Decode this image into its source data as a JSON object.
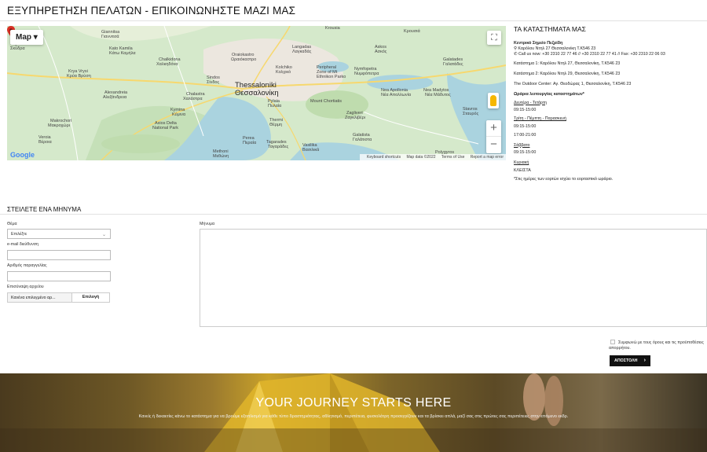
{
  "page_title": "ΕΞΥΠΗΡΕΤΗΣΗ ΠΕΛΑΤΩΝ - ΕΠΙΚΟΙΝΩΝΗΣΤΕ ΜΑΖΙ ΜΑΣ",
  "map": {
    "type_label": "Map",
    "fullscreen_icon": "fullscreen-icon",
    "zoom_in": "+",
    "zoom_out": "−",
    "google": "Google",
    "city_latin": "Thessaloniki",
    "city_greek": "Θεσσαλονίκη",
    "footer": [
      "Keyboard shortcuts",
      "Map data ©2022",
      "Terms of Use",
      "Report a map error"
    ],
    "labels": [
      "Giannitsa",
      "Γιαννιτσά",
      "Krya Vrysi",
      "Κρύα Βρύση",
      "Alexandreia",
      "Αλεξάνδρεια",
      "Makrochori",
      "Μακροχώρι",
      "Veroia",
      "Βέροια",
      "Chalkidona",
      "Χαλκηδόνα",
      "Sindos",
      "Σίνδος",
      "Chalastra",
      "Χαλάστρα",
      "Kymina",
      "Κύμινα",
      "Axios Delta",
      "National Park",
      "Oraiokastro",
      "Ωραιόκαστρο",
      "Langadas",
      "Λαγκαδάς",
      "Krousia",
      "Κρουσιά",
      "Askos",
      "Ασκός",
      "Nea Apollonia",
      "Νέα Απολλωνία",
      "Nea Madytos",
      "Νέα Μάδυτος",
      "Pylaia",
      "Πυλαία",
      "Thermi",
      "Θέρμη",
      "Perea",
      "Περαία",
      "Tagarades",
      "Ταγαράδες",
      "Vasilika",
      "Βασιλικά",
      "Zagliveri",
      "Ζαγκλιβέρι",
      "Nymfopetra",
      "Νυμφόπετρα",
      "Galatista",
      "Γαλάτιστα",
      "Mount Chortiatis",
      "Peripheral",
      "Zone of Mt",
      "Ethnikon Parko",
      "Methoni",
      "Μεθώνη",
      "Polygyros",
      "Stavros",
      "Σταυρός",
      "Kolchiko",
      "Κολχικό",
      "Kato Kamila",
      "Κάτω Καμήλα",
      "Skydra",
      "Σκύδρα",
      "Galatades",
      "Γαλατάδες"
    ]
  },
  "stores": {
    "heading": "ΤΑ ΚΑΤΑΣΤΗΜΑΤΑ ΜΑΣ",
    "hq_title": "Κεντρικό Σημείο Πεζρίδη",
    "hq_address": "Καρόλου Ντηλ 27 Θεσσαλονίκη Τ.Κ546 23",
    "hq_phone": "Call us now: +30 2310 22 77 46 // +30 2310 22 77 41 // Fax: +30 2310 22 06 03",
    "branches": [
      "Κατάστημα 1: Καρόλου Ντηλ 27, Θεσσαλονίκη, Τ.Κ546 23",
      "Κατάστημα 2: Καρόλου Ντηλ 29, Θεσσαλονίκη, Τ.Κ546 23",
      "The Outdoor Center: Αγ. Θεοδώρας 1, Θεσσαλονίκη, Τ.Κ546 23"
    ],
    "hours_title": "Ωράρια λειτουργίας καταστημάτων*",
    "hours": [
      {
        "day": "Δευτέρα - Τετάρτη",
        "times": [
          "09:15-15:00"
        ]
      },
      {
        "day": "Τρίτη - Πέμπτη - Παρασκευή",
        "times": [
          "09:15-15:00",
          "17:00-21:00"
        ]
      },
      {
        "day": "Σάββατο",
        "times": [
          "09:15-15:00"
        ]
      },
      {
        "day": "Κυριακή",
        "times": [
          "ΚΛΕΙΣΤΑ"
        ]
      }
    ],
    "note": "*Στις ημέρες των εορτών ισχύει το εορταστικό ωράριο."
  },
  "form": {
    "heading": "ΣΤΕΙΛΕΤΕ ΕΝΑ ΜΗΝΥΜΑ",
    "subject_label": "Θέμα",
    "subject_value": "Επιλέξτε",
    "email_label": "e-mail διεύθυνση",
    "email_value": "",
    "order_label": "Αριθμός παραγγελίας",
    "order_value": "",
    "file_label": "Επισύναψη αρχείου",
    "file_none": "Κανένα επιλεγμένο αρ...",
    "file_button": "Επιλογή",
    "message_label": "Μήνυμα",
    "consent": "Συμφωνώ με τους όρους και τις προϋποθέσεις απορρήτου.",
    "submit": "ΑΠΟΣΤΟΛΗ",
    "submit_icon": "chevron-right-icon"
  },
  "banner": {
    "title": "YOUR JOURNEY STARTS HERE",
    "subtitle": "Κανείς ή δεκαετίες κάνω το κατάστημα για να βρούμε εξοπλισμό για κάθε τύπο δραστηριότητας, αθλητισμό, περιπέτεια, φυσιολάτρη προσεγγίζουν και τα βρίσκει απλά, μαζί σας στις πρώτες σας περιπέτειες στην επόμενο εκδρ."
  },
  "colors": {
    "water": "#aad3df",
    "land": "#cfe6c6",
    "urban": "#ece7df",
    "road": "#f7d86e",
    "pin": "#d93025",
    "button": "#111111"
  }
}
